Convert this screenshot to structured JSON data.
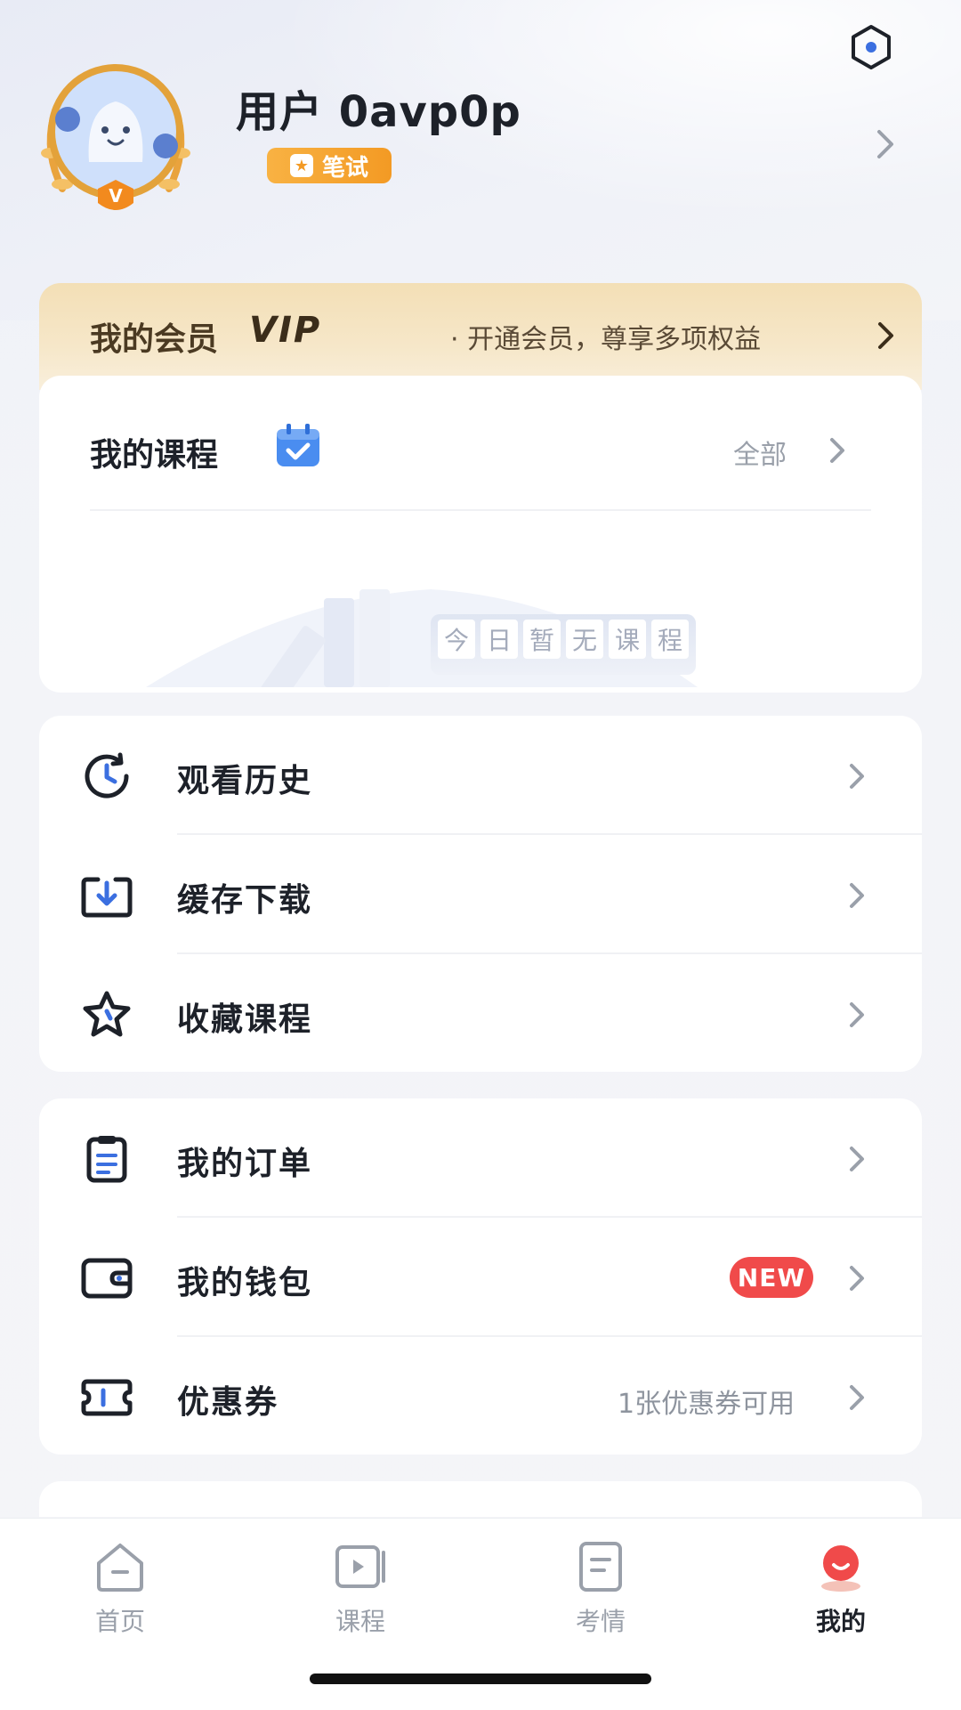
{
  "profile": {
    "username": "用户 0avp0p",
    "badge_label": "笔试",
    "avatar_badge_letter": "V"
  },
  "vip": {
    "title": "我的会员",
    "logo": "VIP",
    "promo": "· 开通会员，尊享多项权益"
  },
  "courses": {
    "title": "我的课程",
    "all_label": "全部",
    "empty_chars": [
      "今",
      "日",
      "暂",
      "无",
      "课",
      "程"
    ]
  },
  "menu_group_1": [
    {
      "label": "观看历史",
      "icon": "history-icon"
    },
    {
      "label": "缓存下载",
      "icon": "download-icon"
    },
    {
      "label": "收藏课程",
      "icon": "star-icon"
    }
  ],
  "menu_group_2": [
    {
      "label": "我的订单",
      "icon": "order-icon"
    },
    {
      "label": "我的钱包",
      "icon": "wallet-icon",
      "badge": "NEW"
    },
    {
      "label": "优惠券",
      "icon": "coupon-icon",
      "note": "1张优惠券可用"
    }
  ],
  "tabbar": [
    {
      "label": "首页",
      "icon": "home-icon",
      "active": false
    },
    {
      "label": "课程",
      "icon": "course-play-icon",
      "active": false
    },
    {
      "label": "考情",
      "icon": "exam-info-icon",
      "active": false
    },
    {
      "label": "我的",
      "icon": "profile-icon",
      "active": true
    }
  ],
  "colors": {
    "accent": "#f04a4a",
    "badge_orange": "#f39a24",
    "vip_gold": "#f3dfb6",
    "calendar_blue": "#4a8df0",
    "icon_dark": "#1d2129"
  }
}
